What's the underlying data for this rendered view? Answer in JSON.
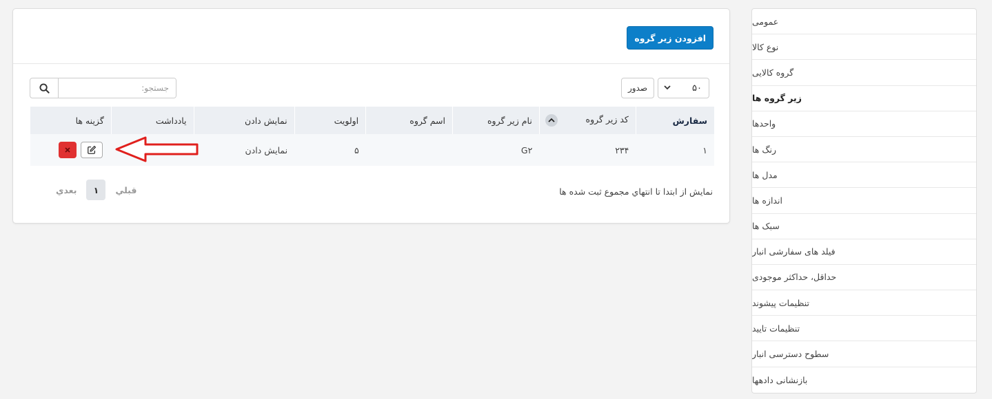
{
  "sidebar": {
    "items": [
      {
        "label": "عمومی",
        "active": false
      },
      {
        "label": "نوع کالا",
        "active": false
      },
      {
        "label": "گروه کالایی",
        "active": false
      },
      {
        "label": "زیر گروه ها",
        "active": true
      },
      {
        "label": "واحدها",
        "active": false
      },
      {
        "label": "رنگ ها",
        "active": false
      },
      {
        "label": "مدل ها",
        "active": false
      },
      {
        "label": "اندازه ها",
        "active": false
      },
      {
        "label": "سبک ها",
        "active": false
      },
      {
        "label": "فیلد های سفارشی انبار",
        "active": false
      },
      {
        "label": "حداقل، حداکثر موجودی",
        "active": false
      },
      {
        "label": "تنظیمات پیشوند",
        "active": false
      },
      {
        "label": "تنظیمات تایید",
        "active": false
      },
      {
        "label": "سطوح دسترسی انبار",
        "active": false
      },
      {
        "label": "بازنشانی دادهها",
        "active": false
      }
    ]
  },
  "header": {
    "add_button_label": "افزودن زیر گروه",
    "accent_color": "#0d7fc9"
  },
  "controls": {
    "page_length": "۵۰",
    "export_label": "صدور",
    "search_placeholder": "جستجو:",
    "search_value": ""
  },
  "table": {
    "columns": [
      "سفارش",
      "کد زیر گروه",
      "نام زیر گروه",
      "اسم گروه",
      "اولویت",
      "نمایش دادن",
      "یادداشت",
      "گزینه ها"
    ],
    "rows": [
      {
        "order": "۱",
        "code": "۲۳۴",
        "name": "G۲",
        "group_name": "",
        "priority": "۵",
        "display": "نمایش دادن",
        "note": ""
      }
    ]
  },
  "footer": {
    "info": "نمایش از ابتدا تا انتهاي مجموع ثبت شده ها",
    "prev_label": "قبلي",
    "current_page": "۱",
    "next_label": "بعدي"
  }
}
